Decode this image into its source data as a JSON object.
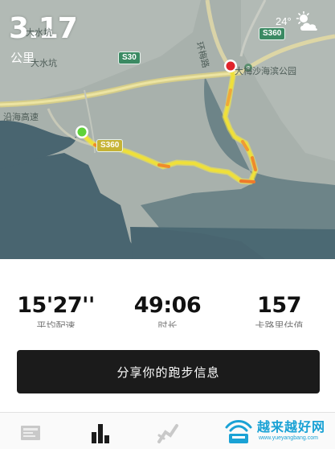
{
  "map": {
    "distance_value": "3.17",
    "distance_unit": "公里",
    "weather": {
      "temperature": "24°",
      "icon": "partly-cloudy-icon"
    },
    "labels": {
      "village_top": "大水坑",
      "village": "大水坑",
      "highway": "沿海高速",
      "ring_road": "环梅路",
      "beach_park": "大梅沙海滨公园"
    },
    "road_badges": {
      "s30": "S30",
      "s360": "S360",
      "s360_lower": "S360"
    },
    "route": {
      "start_marker": "start-point",
      "end_marker": "end-point"
    },
    "colors": {
      "land": "#a9b2ad",
      "water": "#4a6670",
      "route_yellow": "#f2e43a",
      "route_orange": "#f08a2c",
      "start": "#5fd23a",
      "end": "#e0232b"
    }
  },
  "stats": [
    {
      "value": "15'27''",
      "label": "平均配速"
    },
    {
      "value": "49:06",
      "label": "时长"
    },
    {
      "value": "157",
      "label": "卡路里估值"
    }
  ],
  "share_button": "分享你的跑步信息",
  "tabs": [
    {
      "icon": "map-summary-icon",
      "active": false
    },
    {
      "icon": "bar-chart-icon",
      "active": true
    },
    {
      "icon": "splits-icon",
      "active": false
    }
  ],
  "watermark": {
    "title": "越来越好网",
    "url": "www.yueyangbang.com"
  }
}
